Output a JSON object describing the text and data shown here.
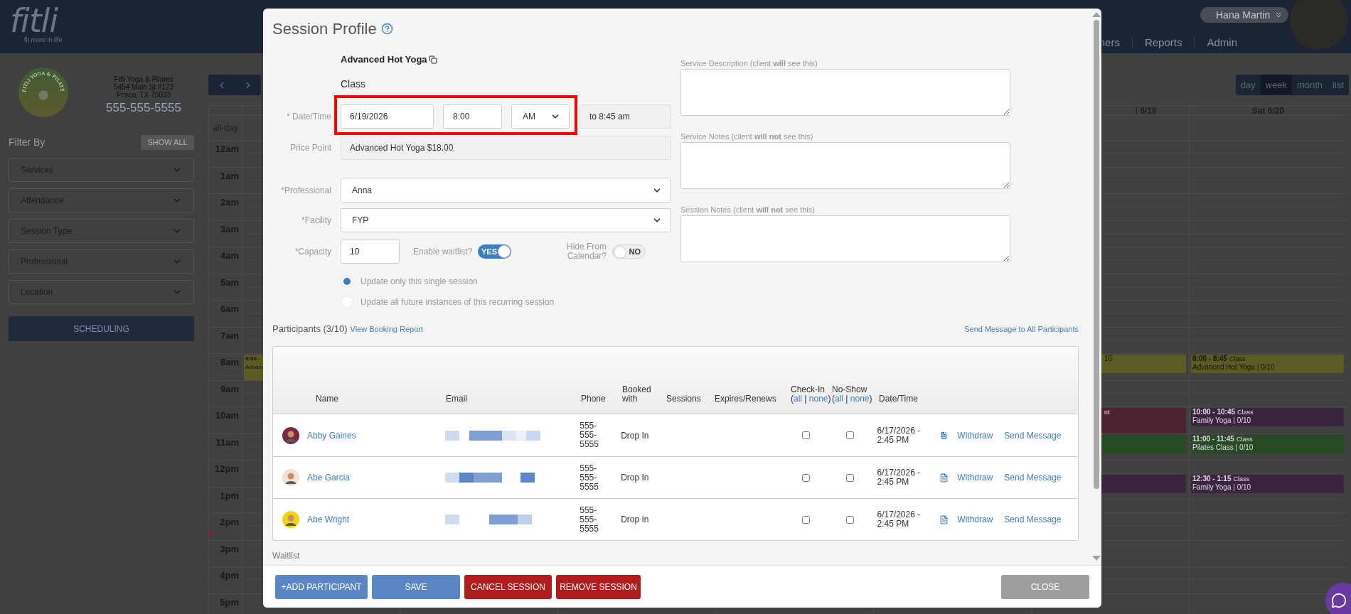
{
  "header": {
    "logo": "fitli",
    "tagline": "fit more in life",
    "nav": [
      "ners",
      "Reports",
      "Admin"
    ],
    "user": "Hana Martin"
  },
  "sidebar": {
    "logo_text": "FITLI YOGA & PILATES",
    "studio_lines": [
      "Fitli Yoga & Pilates",
      "5454 Main St #123",
      "Frisco, TX 75033"
    ],
    "phone": "555-555-5555",
    "filter_title": "Filter By",
    "show_all": "SHOW ALL",
    "filters": [
      "Services",
      "Attendance",
      "Session Type",
      "Professional",
      "Location"
    ],
    "scheduling": "SCHEDULING"
  },
  "calendar": {
    "views": [
      {
        "label": "day",
        "selected": false
      },
      {
        "label": "week",
        "selected": true
      },
      {
        "label": "month",
        "selected": false
      },
      {
        "label": "list",
        "selected": false
      }
    ],
    "all_day": "all-day",
    "hours": [
      "12am",
      "1am",
      "2am",
      "3am",
      "4am",
      "5am",
      "6am",
      "7am",
      "8am",
      "9am",
      "10am",
      "11am",
      "12pm",
      "1pm",
      "2pm",
      "3pm",
      "4pm",
      "5pm"
    ],
    "days": [
      {
        "events": [
          {
            "color": "#5c5b23",
            "time": "8:00 -",
            "name": "Advanc"
          }
        ]
      },
      {
        "header": "i 6/19",
        "events": [
          {
            "color": "#5c5b23",
            "name": "10"
          },
          {
            "color": "#4d2233",
            "type": "nt"
          },
          {
            "color": "#264a22"
          },
          {
            "color": "#3a2440"
          }
        ]
      },
      {
        "header": "Sat 6/20",
        "events": [
          {
            "color": "#5c5b23",
            "time": "8:00 - 8:45",
            "type": "Class",
            "name": "Advanced Hot Yoga | 0/10"
          },
          {
            "color": "#3a2440",
            "time": "10:00 - 10:45",
            "type": "Class",
            "name": "Family Yoga | 0/10"
          },
          {
            "color": "#264a22",
            "time": "11:00 - 11:45",
            "type": "Class",
            "name": "Pilates Class | 0/10"
          },
          {
            "color": "#3a2440",
            "time": "12:30 - 1:15",
            "type": "Class",
            "name": "Family Yoga | 0/10"
          }
        ]
      }
    ]
  },
  "modal": {
    "title": "Session Profile",
    "service": "Advanced Hot Yoga",
    "service_type": "Class",
    "date_label": "* Date/Time",
    "date": "6/19/2026",
    "time": "8:00",
    "meridiem": "AM",
    "end_time": "to 8:45 am",
    "price_label": "Price Point",
    "price": "Advanced Hot Yoga $18.00",
    "professional_label": "*Professional",
    "professional": "Anna",
    "facility_label": "*Facility",
    "facility": "FYP",
    "capacity_label": "*Capacity",
    "capacity": "10",
    "toggles": [
      {
        "label": "Enable waitlist?",
        "on": true,
        "text": "YES"
      },
      {
        "label": "Hide From Calendar?",
        "on": false,
        "text": "NO"
      }
    ],
    "scope_options": [
      {
        "label": "Update only this single session",
        "selected": true
      },
      {
        "label": "Update all future instances of this recurring session",
        "selected": false
      }
    ],
    "notes": [
      "Service Description (client **will** see this)",
      "Service Notes (client **will not** see this)",
      "Session Notes (client **will not** see this)"
    ],
    "participants_title": "Participants (3/10)",
    "booking_report": "View Booking Report",
    "message_all": "Send Message to All Participants",
    "table": {
      "columns": [
        {
          "label": "Name"
        },
        {
          "label": "Email"
        },
        {
          "label": "Phone"
        },
        {
          "label": "Booked with"
        },
        {
          "label": "Sessions"
        },
        {
          "label": "Expires/Renews"
        },
        {
          "label": "Check-In",
          "links": [
            "all",
            "none"
          ]
        },
        {
          "label": "No-Show",
          "links": [
            "all",
            "none"
          ]
        },
        {
          "label": "Date/Time"
        }
      ],
      "bulk_open": "(",
      "bulk_divider": "|",
      "bulk_close": ")",
      "rows": [
        {
          "name": "Abby Gaines",
          "color": "#7a2a3a",
          "phone": "555-555-5555",
          "booked_with": "Drop In",
          "check_in": false,
          "no_show": false,
          "datetime": "6/17/2026 - 2:45 PM",
          "document_filled": true,
          "actions": [
            "Withdraw",
            "Send Message"
          ]
        },
        {
          "name": "Abe Garcia",
          "color": "#f1e2d3",
          "phone": "555-555-5555",
          "booked_with": "Drop In",
          "check_in": false,
          "no_show": false,
          "datetime": "6/17/2026 - 2:45 PM",
          "document_filled": false,
          "actions": [
            "Withdraw",
            "Send Message"
          ]
        },
        {
          "name": "Abe Wright",
          "color": "#f2d411",
          "phone": "555-555-5555",
          "booked_with": "Drop In",
          "check_in": false,
          "no_show": false,
          "datetime": "6/17/2026 - 2:45 PM",
          "document_filled": false,
          "actions": [
            "Withdraw",
            "Send Message"
          ]
        }
      ]
    },
    "waitlist": "Waitlist",
    "buttons": [
      {
        "label": "+ADD PARTICIPANT",
        "kind": "primary"
      },
      {
        "label": "SAVE",
        "kind": "primary"
      },
      {
        "label": "CANCEL SESSION",
        "kind": "danger"
      },
      {
        "label": "REMOVE SESSION",
        "kind": "danger"
      }
    ],
    "close": "CLOSE"
  }
}
